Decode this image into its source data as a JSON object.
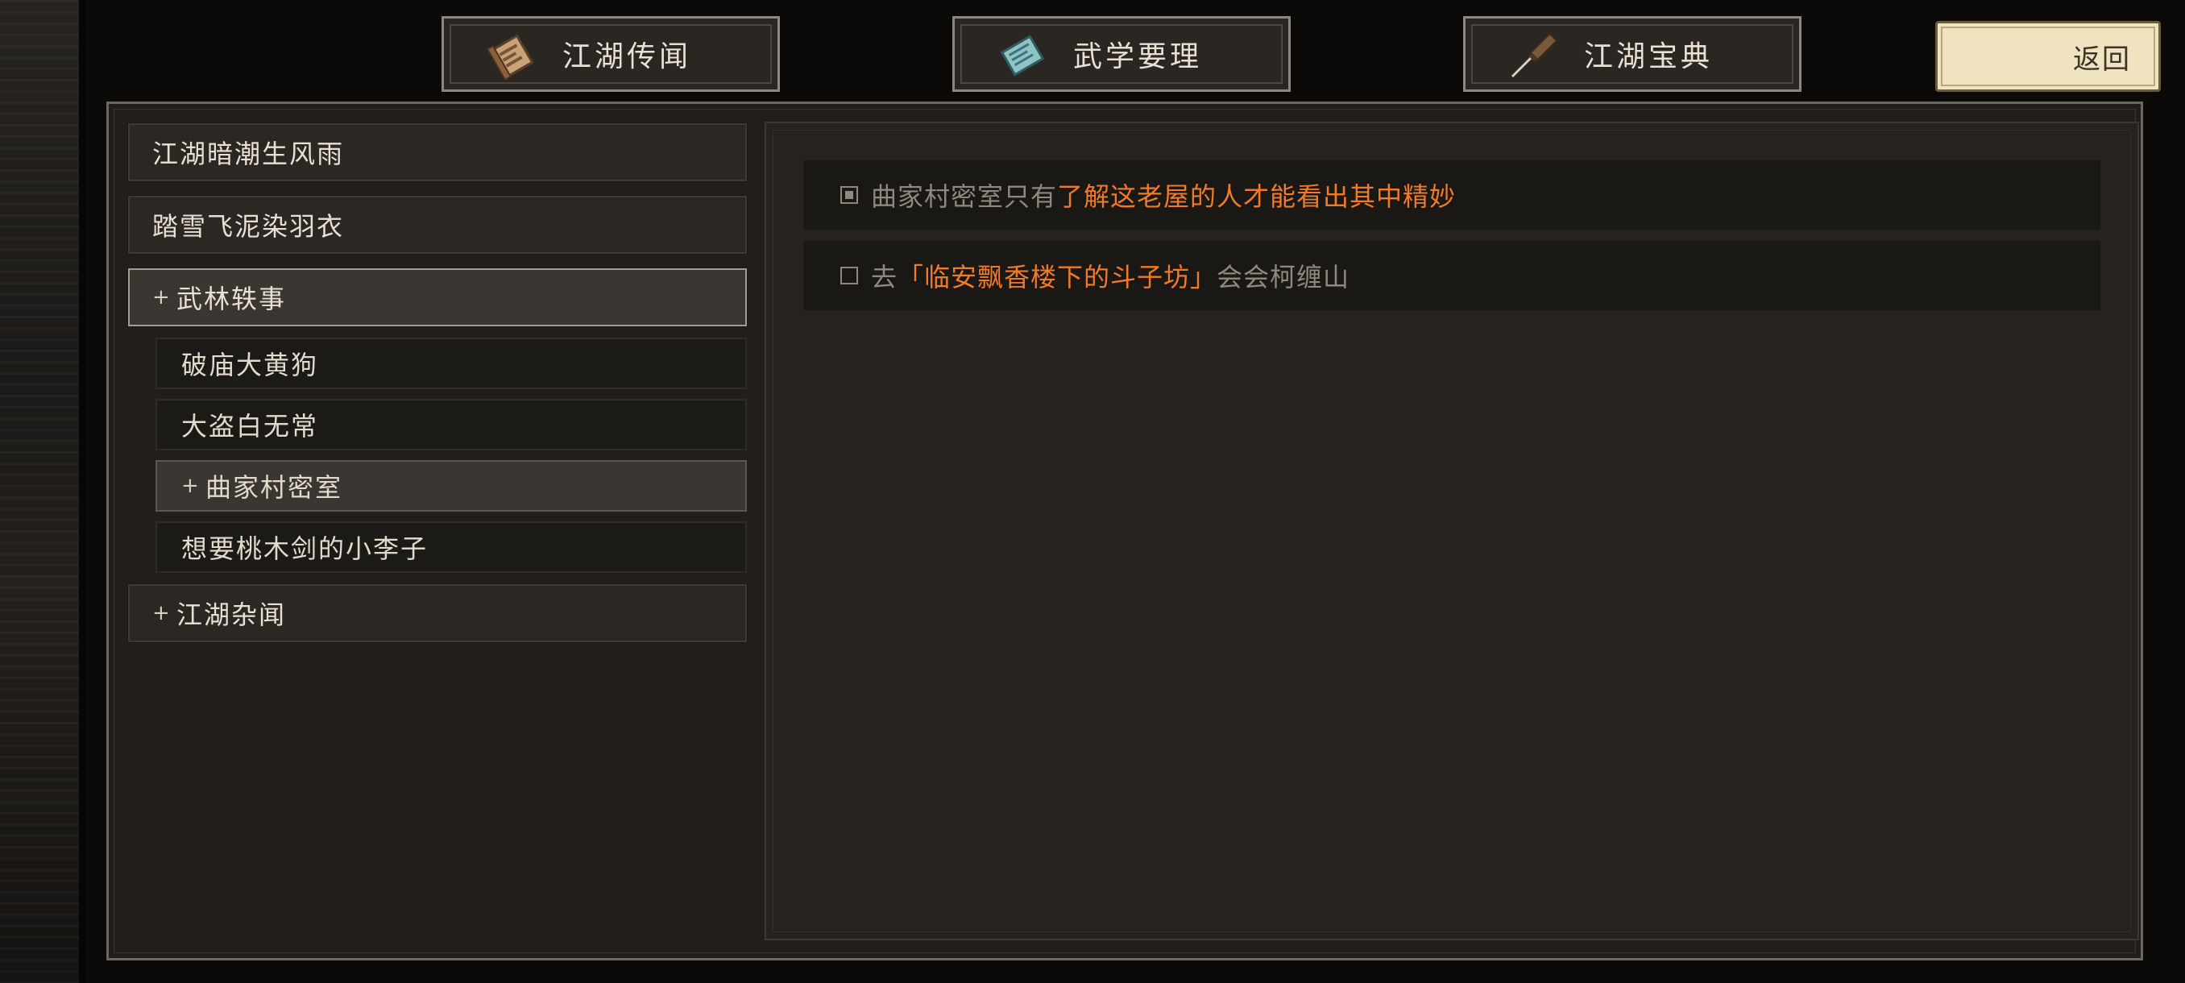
{
  "tabs": [
    {
      "label": "江湖传闻",
      "icon": "scroll-icon"
    },
    {
      "label": "武学要理",
      "icon": "manual-icon"
    },
    {
      "label": "江湖宝典",
      "icon": "brush-icon"
    }
  ],
  "return_label": "返回",
  "categories": [
    {
      "label": "江湖暗潮生风雨"
    },
    {
      "label": "踏雪飞泥染羽衣"
    },
    {
      "label": "武林轶事",
      "bullet": "+"
    },
    {
      "label": "江湖杂闻",
      "bullet": "+"
    }
  ],
  "sub_items": [
    {
      "label": "破庙大黄狗"
    },
    {
      "label": "大盗白无常"
    },
    {
      "label": "曲家村密室",
      "bullet": "+"
    },
    {
      "label": "想要桃木剑的小李子"
    }
  ],
  "objectives": [
    {
      "checked": true,
      "prefix": "曲家村密室只有",
      "highlight": "了解这老屋的人才能看出其中精妙",
      "suffix": ""
    },
    {
      "checked": false,
      "prefix": "去",
      "highlight": "「临安飘香楼下的斗子坊」",
      "suffix": "会会柯缠山"
    }
  ],
  "colors": {
    "highlight": "#f07a2a",
    "text_dim": "#8f887b",
    "text_light": "#e8e1d3",
    "button_cream": "#efe3c0"
  }
}
